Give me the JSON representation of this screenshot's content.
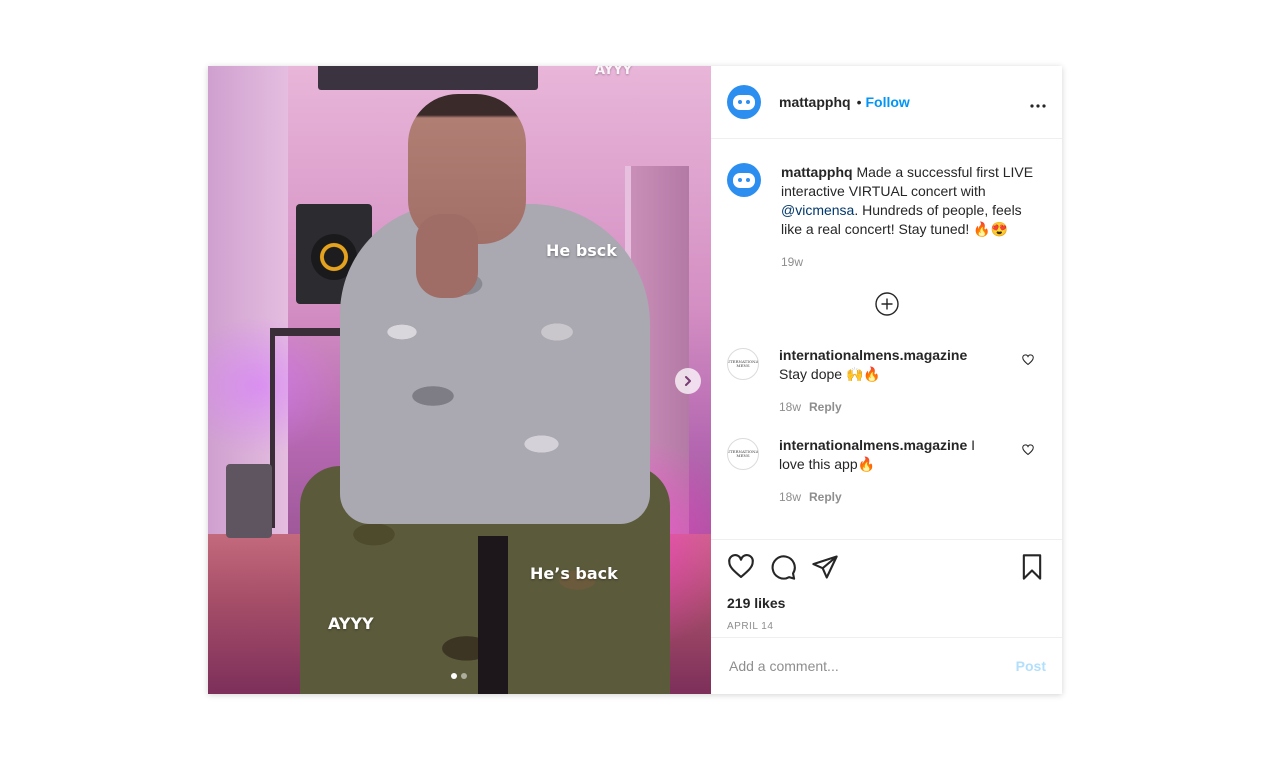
{
  "post": {
    "username": "mattapphq",
    "separator": "•",
    "follow_label": "Follow",
    "more_label": "•••",
    "caption_user": "mattapphq",
    "caption_text_1": " Made a successful first LIVE interactive VIRTUAL concert with ",
    "caption_mention": "@vicmensa",
    "caption_text_2": ". Hundreds of people, feels like a real concert! Stay tuned! 🔥😍",
    "caption_time": "19w",
    "likes": "219 likes",
    "date": "APRIL 14"
  },
  "media": {
    "overlay_ayyy_top": "AYYY",
    "overlay_he_bsck": "He bsck",
    "overlay_hes_back": "He’s back",
    "overlay_ayyy_bottom": "AYYY",
    "carousel_count": 2,
    "carousel_active": 1
  },
  "comments": [
    {
      "user": "internationalmens.magazine",
      "text": "Stay dope 🙌🔥",
      "time": "18w",
      "reply_label": "Reply",
      "avatar_text": "INTERNATIONAL MENS"
    },
    {
      "user": "internationalmens.magazine",
      "text": "I love this app🔥",
      "time": "18w",
      "reply_label": "Reply",
      "avatar_text": "INTERNATIONAL MENS"
    }
  ],
  "composer": {
    "placeholder": "Add a comment...",
    "post_label": "Post"
  },
  "icons": [
    "chevron-right-icon",
    "plus-circle-icon",
    "heart-icon",
    "comment-icon",
    "share-icon",
    "bookmark-icon",
    "more-icon"
  ],
  "colors": {
    "accent": "#0095f6",
    "post_disabled": "#b2dffc",
    "avatar_bg": "#2c8ff0",
    "muted": "#8e8e8e"
  }
}
